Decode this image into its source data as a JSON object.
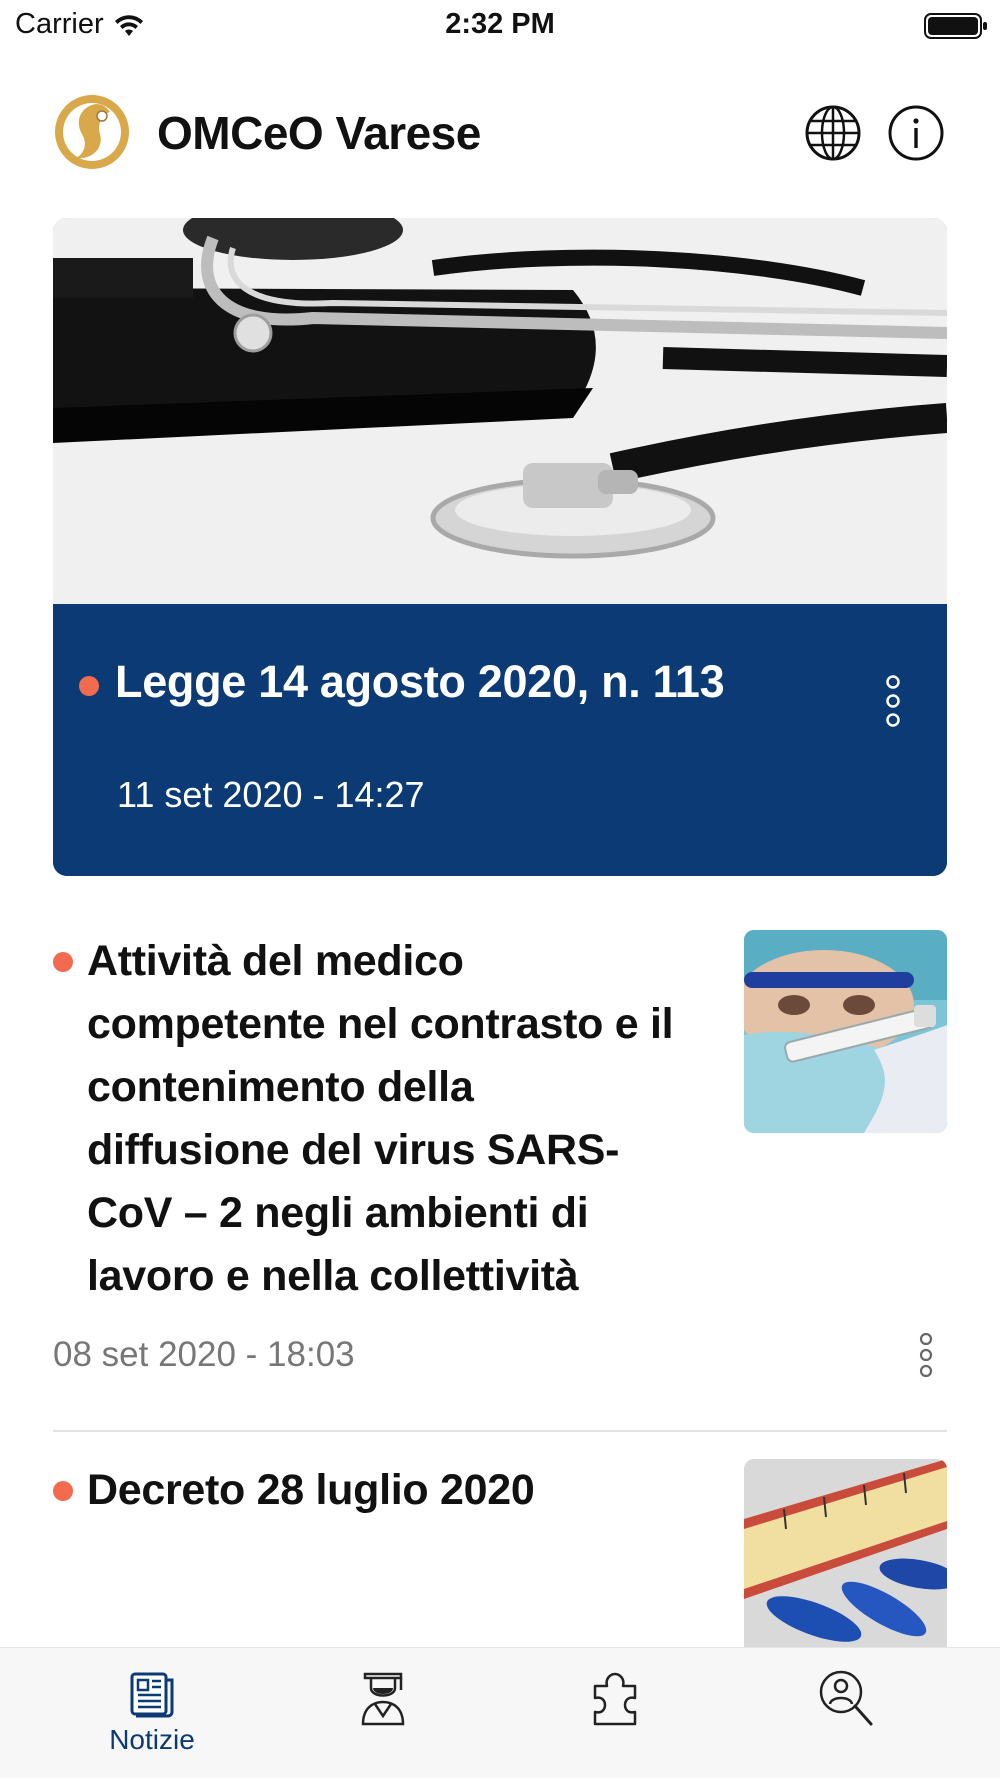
{
  "status_bar": {
    "carrier": "Carrier",
    "time": "2:32 PM"
  },
  "header": {
    "title": "OMCeO Varese",
    "logo_icon": "omceo-logo-icon",
    "globe_icon": "globe-icon",
    "info_icon": "info-icon"
  },
  "featured": {
    "title": "Legge 14 agosto 2020, n. 113",
    "date": "11 set 2020 - 14:27",
    "image_icon": "stethoscope-image"
  },
  "news": [
    {
      "title": "Attività del medico competente nel contrasto e il contenimento della diffusione del virus SARS-CoV – 2 negli ambienti di lavoro e nella collettività",
      "date": "08 set 2020 - 18:03",
      "image_icon": "coronavirus-test-image"
    },
    {
      "title": "Decreto 28 luglio 2020",
      "image_icon": "tape-measure-pills-image"
    }
  ],
  "tabs": [
    {
      "label": "Notizie",
      "icon": "newspaper-icon",
      "active": true
    },
    {
      "label": "",
      "icon": "graduate-icon",
      "active": false
    },
    {
      "label": "",
      "icon": "puzzle-icon",
      "active": false
    },
    {
      "label": "",
      "icon": "search-person-icon",
      "active": false
    }
  ],
  "colors": {
    "accent": "#0b3a75",
    "dot": "#f26b4e",
    "date_gray": "#777777"
  }
}
